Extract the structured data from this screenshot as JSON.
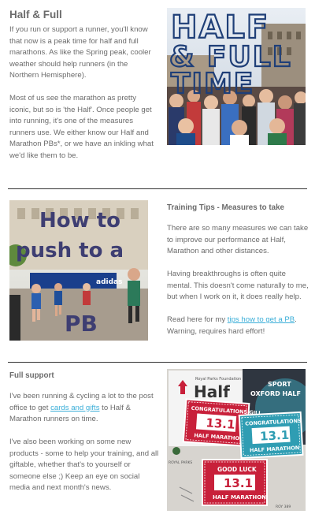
{
  "section1": {
    "title": "Half & Full",
    "para1": "If you run or support a runner, you'll know that now is a peak time for half and full marathons.  As like the Spring peak, cooler weather should help runners (in the Northern Hemisphere).",
    "para2": "Most of us see the marathon as pretty iconic, but so is 'the Half'.  Once people get into running, it's one of the measures runners use. We either know our Half and Marathon PBs*, or we have an inkling what we'd like them to be.",
    "image": {
      "line1": "HALF",
      "line2": "& FULL",
      "line3": "TIME"
    }
  },
  "section2": {
    "title": "Training Tips - Measures to take",
    "para1": "There are so many measures we can take to improve our performance at Half, Marathon and other distances.",
    "para2": "Having breakthroughs is often quite mental.  This doesn't come naturally to me, but when I work on it, it does really help.",
    "para3_pre": "Read here for my ",
    "para3_link": "tips how to get a PB",
    "para3_post": ". Warning, requires hard effort!",
    "image": {
      "line1": "How to",
      "line2": "push to a",
      "line3": "PB",
      "banner": "adidas"
    }
  },
  "section3": {
    "title": "Full support",
    "para1_pre": "I've been running & cycling a lot to the post office to get ",
    "para1_link": "cards and gifts",
    "para1_post": " to Half & Marathon runners on time.",
    "para2": "I've also been working on some new products - some to help your training, and all giftable, whether that's to yourself or someone else ;) Keep an eye on social media and next month's news.",
    "image": {
      "card1_top": "CONGRATULATIONS GILL",
      "card1_num": "13.1",
      "card1_bottom": "HALF MARATHON",
      "card2_top": "CONGRATULATIONS",
      "card2_num": "13.1",
      "card2_bottom": "HALF MARATHON",
      "card3_top": "GOOD LUCK",
      "card3_num": "13.1",
      "card3_bottom": "HALF MARATHON",
      "bib_title": "Half",
      "bib_small": "Royal Parks Foundation",
      "oxford_top": "SPORT",
      "oxford_bottom": "OXFORD HALF",
      "bib_number": "ROY 389",
      "royal_parks": "ROYAL PARKS"
    }
  },
  "colors": {
    "text": "#6b6b6b",
    "link": "#3aaed8",
    "divider": "#333333",
    "title_blue": "#1f3f78",
    "card_red": "#c8203a",
    "card_teal": "#2f9db3"
  }
}
